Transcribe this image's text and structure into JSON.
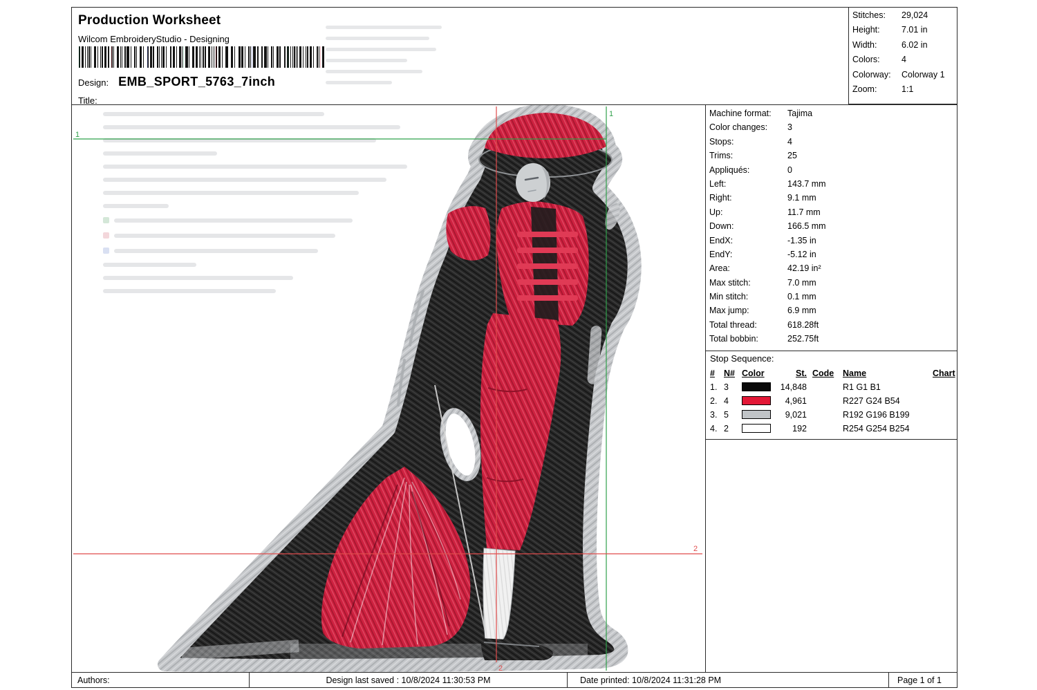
{
  "header": {
    "title": "Production Worksheet",
    "subtitle": "Wilcom EmbroideryStudio - Designing",
    "design_label": "Design:",
    "design_name": "EMB_SPORT_5763_7inch",
    "title_label": "Title:"
  },
  "summary": {
    "rows": [
      {
        "label": "Stitches:",
        "value": "29,024"
      },
      {
        "label": "Height:",
        "value": "7.01 in"
      },
      {
        "label": "Width:",
        "value": "6.02 in"
      },
      {
        "label": "Colors:",
        "value": "4"
      },
      {
        "label": "Colorway:",
        "value": "Colorway 1"
      },
      {
        "label": "Zoom:",
        "value": "1:1"
      }
    ]
  },
  "machine_info": {
    "rows": [
      {
        "label": "Machine format:",
        "value": "Tajima"
      },
      {
        "label": "Color changes:",
        "value": "3"
      },
      {
        "label": "Stops:",
        "value": "4"
      },
      {
        "label": "Trims:",
        "value": "25"
      },
      {
        "label": "Appliqués:",
        "value": "0"
      },
      {
        "label": "Left:",
        "value": "143.7 mm"
      },
      {
        "label": "Right:",
        "value": "9.1 mm"
      },
      {
        "label": "Up:",
        "value": "11.7 mm"
      },
      {
        "label": "Down:",
        "value": "166.5 mm"
      },
      {
        "label": "EndX:",
        "value": "-1.35 in"
      },
      {
        "label": "EndY:",
        "value": "-5.12 in"
      },
      {
        "label": "Area:",
        "value": "42.19 in²"
      },
      {
        "label": "Max stitch:",
        "value": "7.0 mm"
      },
      {
        "label": "Min stitch:",
        "value": "0.1 mm"
      },
      {
        "label": "Max jump:",
        "value": "6.9 mm"
      },
      {
        "label": "Total thread:",
        "value": "618.28ft"
      },
      {
        "label": "Total bobbin:",
        "value": "252.75ft"
      }
    ]
  },
  "stop_sequence": {
    "title": "Stop Sequence:",
    "columns": {
      "num": "#",
      "n": "N#",
      "color": "Color",
      "st": "St.",
      "code": "Code",
      "name": "Name",
      "chart": "Chart"
    },
    "rows": [
      {
        "num": "1.",
        "n": "3",
        "swatch": "#0a0a0a",
        "st": "14,848",
        "code": "",
        "name": "R1 G1 B1"
      },
      {
        "num": "2.",
        "n": "4",
        "swatch": "#e31836",
        "st": "4,961",
        "code": "",
        "name": "R227 G24 B54"
      },
      {
        "num": "3.",
        "n": "5",
        "swatch": "#c0c4c7",
        "st": "9,021",
        "code": "",
        "name": "R192 G196 B199"
      },
      {
        "num": "4.",
        "n": "2",
        "swatch": "#fefefe",
        "st": "192",
        "code": "",
        "name": "R254 G254 B254"
      }
    ]
  },
  "canvas": {
    "start_marker": "1",
    "end_marker": "2",
    "guide_color_green": "#2fa04a",
    "guide_color_red": "#e04b4b"
  },
  "footer": {
    "authors_label": "Authors:",
    "last_saved": "Design last saved : 10/8/2024 11:30:53 PM",
    "date_printed": "Date printed: 10/8/2024 11:31:28 PM",
    "page": "Page 1 of 1"
  }
}
